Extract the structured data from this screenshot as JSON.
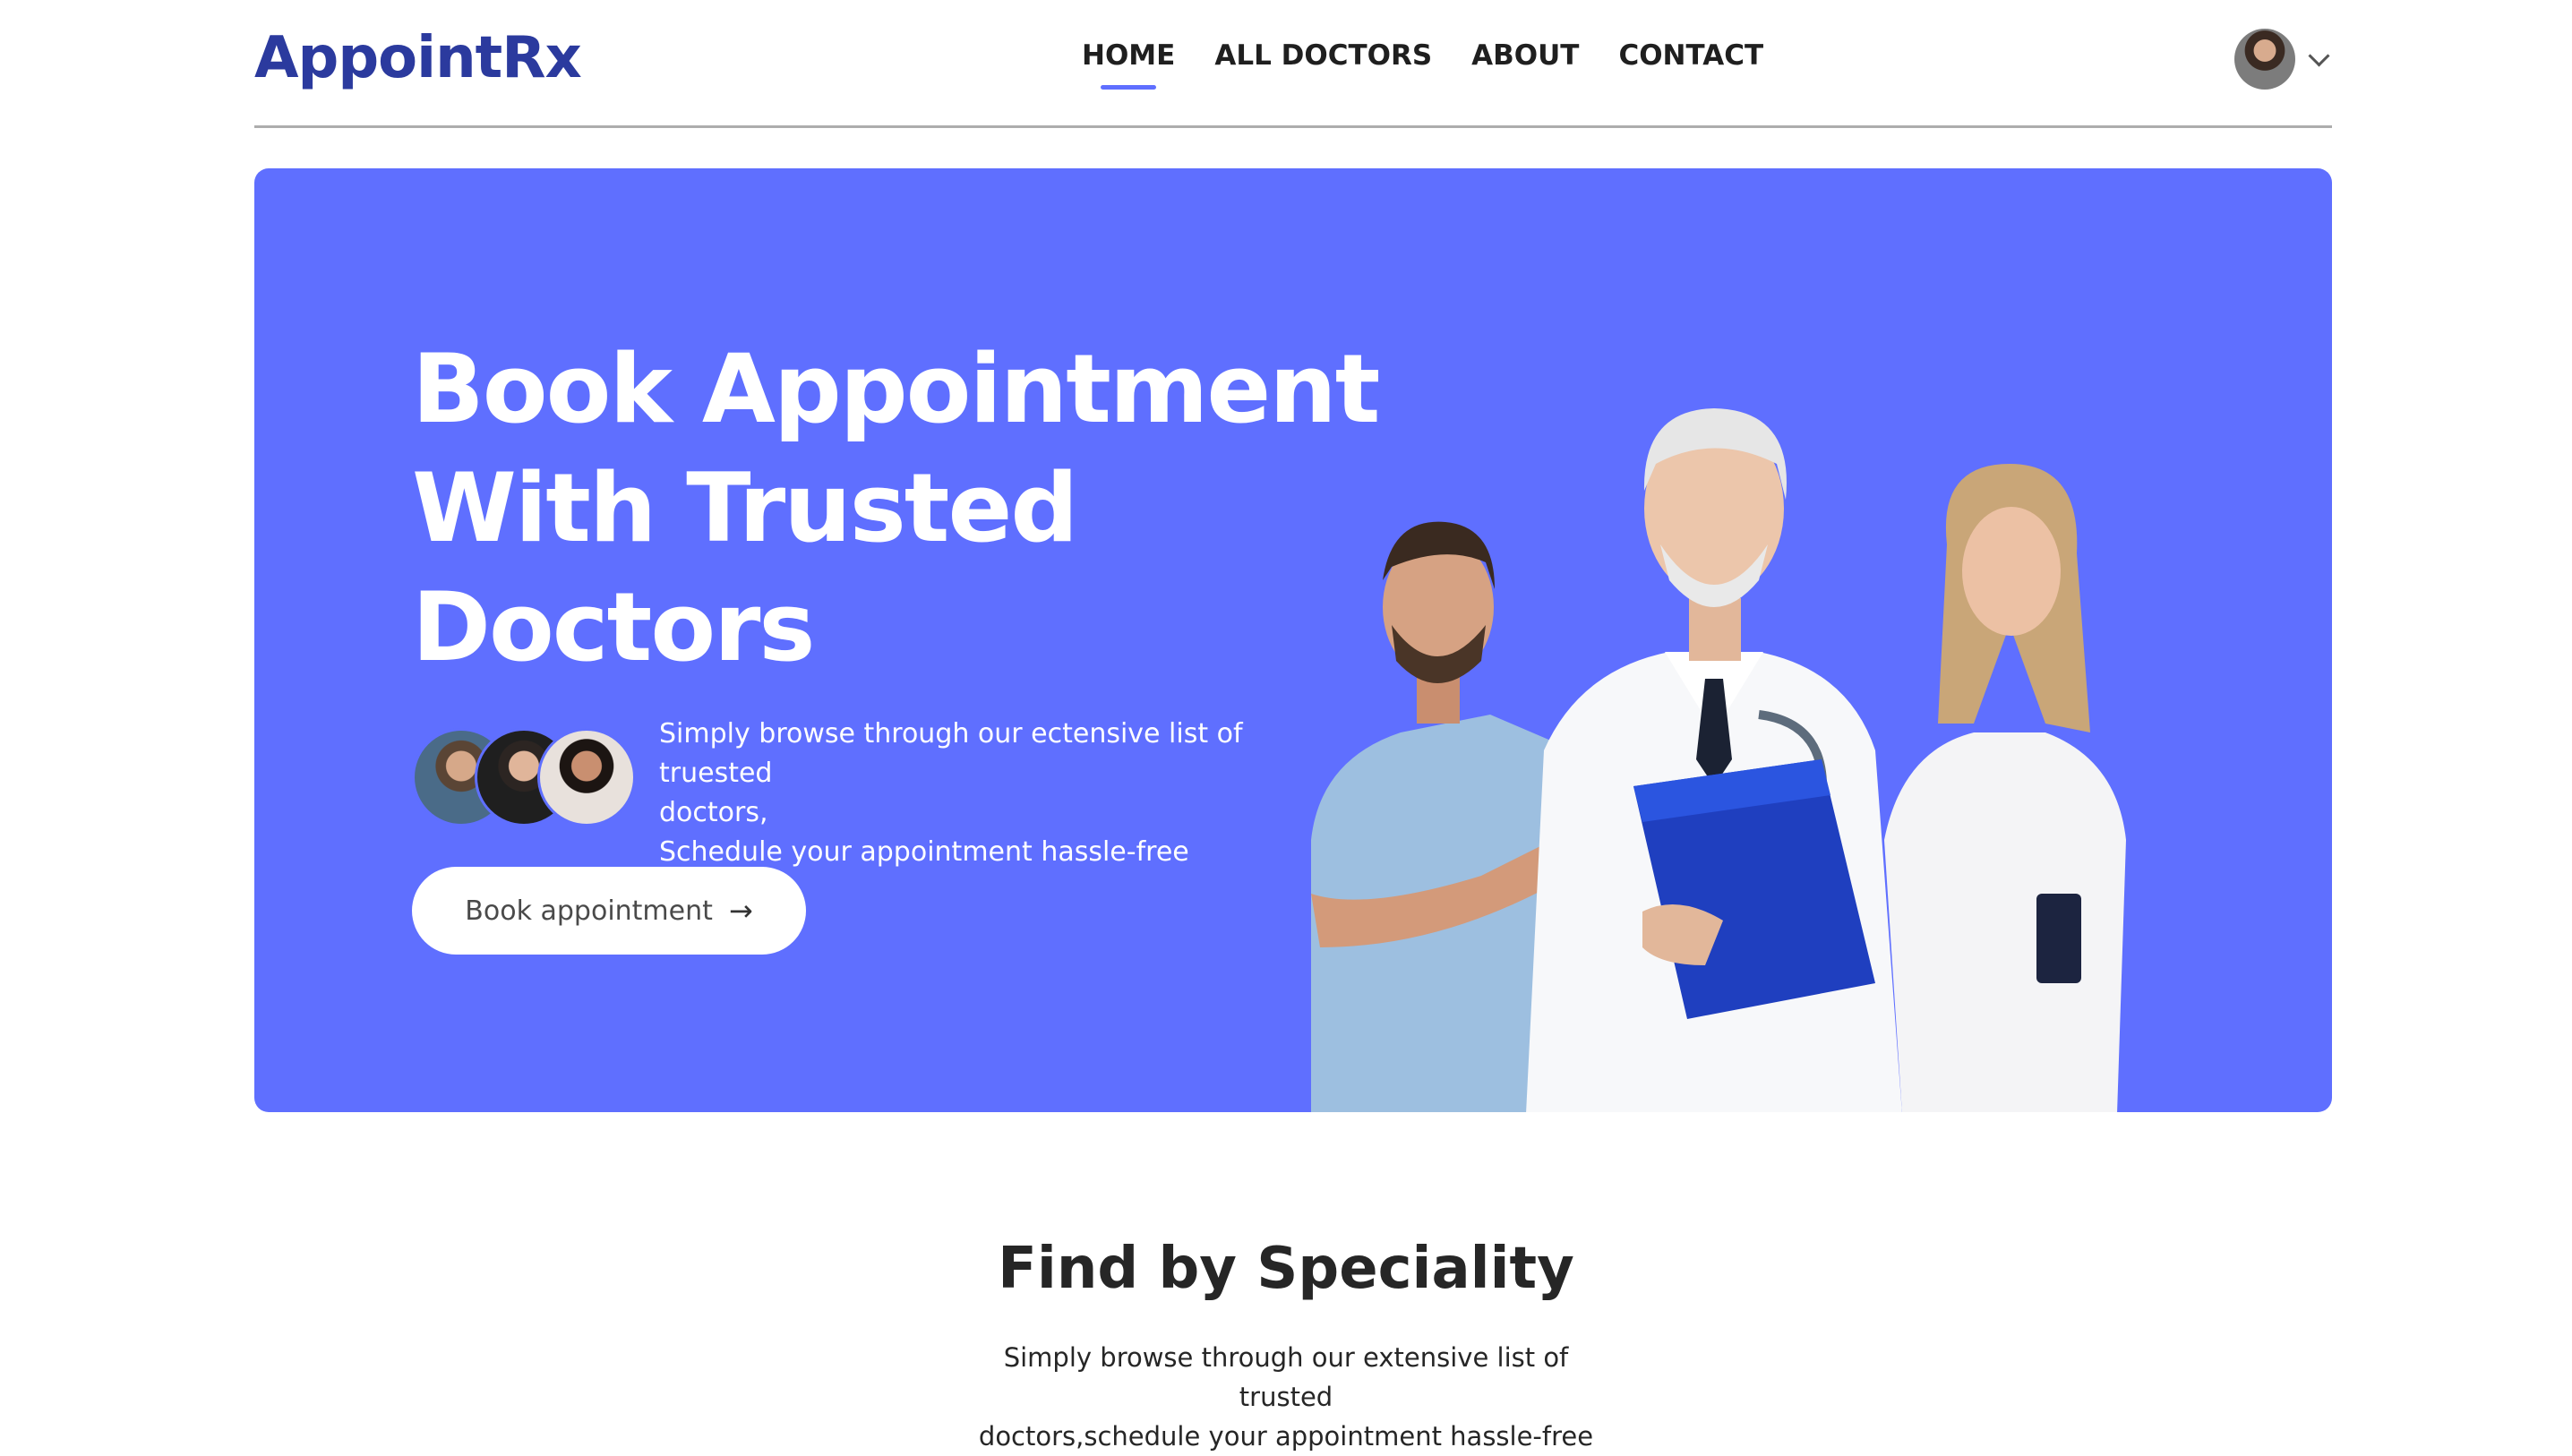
{
  "brand": {
    "logo": "AppointRx",
    "accent": "#5f6fff",
    "logo_color": "#2b3a9e"
  },
  "nav": {
    "items": [
      {
        "label": "HOME",
        "active": true
      },
      {
        "label": "ALL DOCTORS",
        "active": false
      },
      {
        "label": "ABOUT",
        "active": false
      },
      {
        "label": "CONTACT",
        "active": false
      }
    ]
  },
  "profile": {
    "avatar_icon": "user-avatar",
    "dropdown_icon": "chevron-down-icon"
  },
  "hero": {
    "title_lines": [
      "Book Appointment",
      "With Trusted",
      "Doctors"
    ],
    "description_lines": [
      "Simply browse through our ectensive list of truested",
      "doctors,",
      "Schedule your appointment hassle-free"
    ],
    "button_label": "Book appointment",
    "button_icon": "arrow-right-icon"
  },
  "speciality": {
    "title": "Find by Speciality",
    "description_lines": [
      "Simply browse through our extensive list of trusted",
      "doctors,schedule your appointment hassle-free"
    ]
  }
}
